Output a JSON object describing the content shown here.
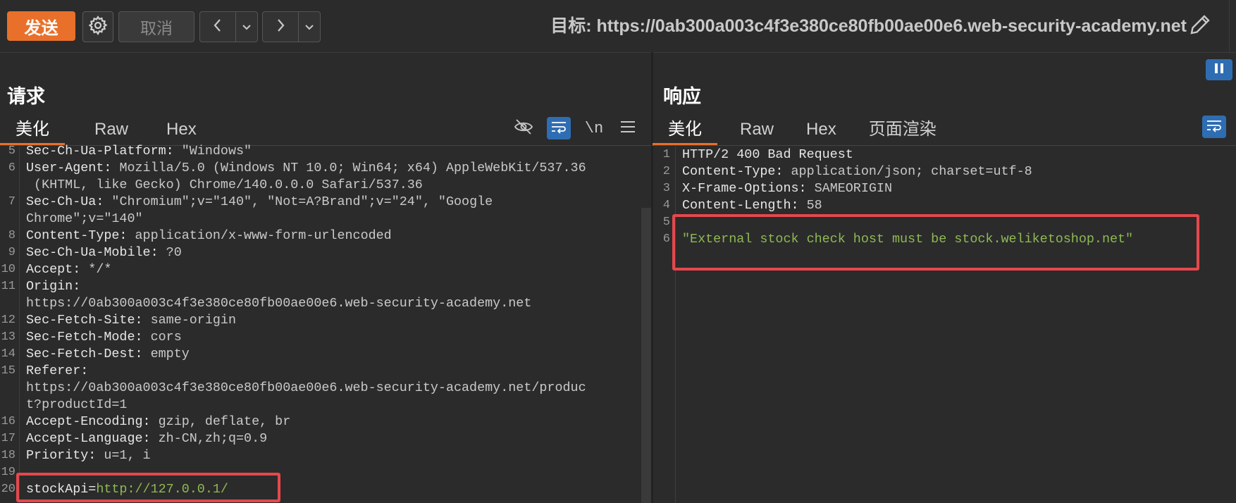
{
  "toolbar": {
    "send_label": "发送",
    "cancel_label": "取消",
    "target_label": "目标: https://0ab300a003c4f3e380ce80fb00ae00e6.web-security-academy.net"
  },
  "request": {
    "title": "请求",
    "tabs": [
      "美化",
      "Raw",
      "Hex"
    ],
    "active_tab": "美化",
    "newline_toggle": "\\n",
    "lines": [
      {
        "num": "5",
        "key": "Sec-Ch-Ua-Platform:",
        "val": " \"Windows\""
      },
      {
        "num": "6",
        "key": "User-Agent:",
        "val": " Mozilla/5.0 (Windows NT 10.0; Win64; x64) AppleWebKit/537.36"
      },
      {
        "num": "",
        "key": "",
        "val": " (KHTML, like Gecko) Chrome/140.0.0.0 Safari/537.36"
      },
      {
        "num": "7",
        "key": "Sec-Ch-Ua:",
        "val": " \"Chromium\";v=\"140\", \"Not=A?Brand\";v=\"24\", \"Google"
      },
      {
        "num": "",
        "key": "",
        "val": "Chrome\";v=\"140\""
      },
      {
        "num": "8",
        "key": "Content-Type:",
        "val": " application/x-www-form-urlencoded"
      },
      {
        "num": "9",
        "key": "Sec-Ch-Ua-Mobile:",
        "val": " ?0"
      },
      {
        "num": "10",
        "key": "Accept:",
        "val": " */*"
      },
      {
        "num": "11",
        "key": "Origin:",
        "val": ""
      },
      {
        "num": "",
        "key": "",
        "val": "https://0ab300a003c4f3e380ce80fb00ae00e6.web-security-academy.net"
      },
      {
        "num": "12",
        "key": "Sec-Fetch-Site:",
        "val": " same-origin"
      },
      {
        "num": "13",
        "key": "Sec-Fetch-Mode:",
        "val": " cors"
      },
      {
        "num": "14",
        "key": "Sec-Fetch-Dest:",
        "val": " empty"
      },
      {
        "num": "15",
        "key": "Referer:",
        "val": ""
      },
      {
        "num": "",
        "key": "",
        "val": "https://0ab300a003c4f3e380ce80fb00ae00e6.web-security-academy.net/produc"
      },
      {
        "num": "",
        "key": "",
        "val": "t?productId=1"
      },
      {
        "num": "16",
        "key": "Accept-Encoding:",
        "val": " gzip, deflate, br"
      },
      {
        "num": "17",
        "key": "Accept-Language:",
        "val": " zh-CN,zh;q=0.9"
      },
      {
        "num": "18",
        "key": "Priority:",
        "val": " u=1, i"
      },
      {
        "num": "19",
        "key": "",
        "val": ""
      },
      {
        "num": "20",
        "key": "stockApi=",
        "val": "http://127.0.0.1/",
        "green": true
      }
    ]
  },
  "response": {
    "title": "响应",
    "tabs": [
      "美化",
      "Raw",
      "Hex",
      "页面渲染"
    ],
    "active_tab": "美化",
    "lines": [
      {
        "num": "1",
        "key": "HTTP/2 400 Bad Request",
        "val": ""
      },
      {
        "num": "2",
        "key": "Content-Type:",
        "val": " application/json; charset=utf-8"
      },
      {
        "num": "3",
        "key": "X-Frame-Options:",
        "val": " SAMEORIGIN"
      },
      {
        "num": "4",
        "key": "Content-Length:",
        "val": " 58"
      },
      {
        "num": "5",
        "key": "",
        "val": ""
      },
      {
        "num": "6",
        "key": "",
        "val": "\"External stock check host must be stock.weliketoshop.net\"",
        "green": true
      }
    ]
  },
  "colors": {
    "accent": "#e8702a",
    "highlight_box": "#e5484d",
    "string_green": "#8fb954",
    "toggle_blue": "#2f6db3"
  },
  "icons": [
    "gear-icon",
    "chevron-left-icon",
    "chevron-down-icon",
    "chevron-right-icon",
    "pencil-icon",
    "pause-icon",
    "eye-off-icon",
    "wrap-icon",
    "menu-icon"
  ]
}
